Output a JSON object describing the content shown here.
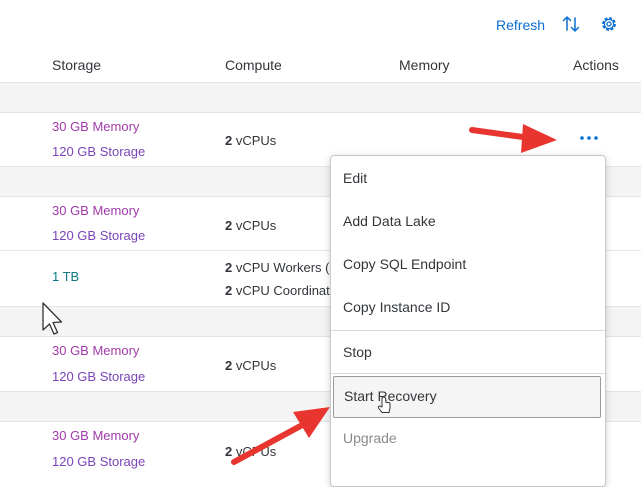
{
  "toolbar": {
    "refresh_label": "Refresh",
    "sort_icon": "sort-icon",
    "settings_icon": "gear-icon"
  },
  "table": {
    "columns": [
      "Storage",
      "Compute",
      "Memory",
      "Actions"
    ],
    "rows": [
      {
        "memory": "30 GB Memory",
        "storage": "120 GB Storage",
        "compute_num": "2",
        "compute_unit": " vCPUs"
      },
      {
        "memory": "30 GB Memory",
        "storage": "120 GB Storage",
        "compute_num": "2",
        "compute_unit": " vCPUs"
      },
      {
        "size": "1 TB",
        "compute_num": "2",
        "compute_unit": " vCPU Workers (",
        "compute2_num": "2",
        "compute2_unit": " vCPU Coordinat"
      },
      {
        "memory": "30 GB Memory",
        "storage": "120 GB Storage",
        "compute_num": "2",
        "compute_unit": " vCPUs"
      },
      {
        "memory": "30 GB Memory",
        "storage": "120 GB Storage",
        "compute_num": "2",
        "compute_unit": " vCPUs"
      }
    ]
  },
  "menu": {
    "items": [
      "Edit",
      "Add Data Lake",
      "Copy SQL Endpoint",
      "Copy Instance ID",
      "Stop",
      "Start Recovery",
      "Upgrade"
    ]
  },
  "colors": {
    "link": "#0a6ed1",
    "memory_text": "#a13aa9",
    "storage_text": "#7a45b8",
    "tb_text": "#0b7a82",
    "annotation_arrow": "#e8352f"
  }
}
